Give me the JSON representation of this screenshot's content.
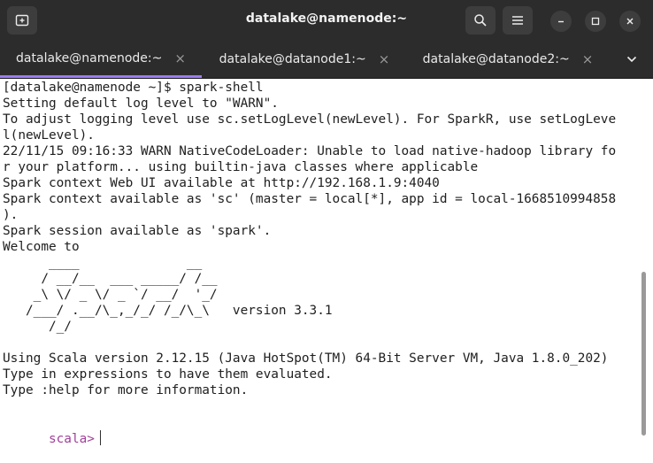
{
  "window": {
    "title": "datalake@namenode:~"
  },
  "tabs": [
    {
      "label": "datalake@namenode:~",
      "close": "×",
      "active": true
    },
    {
      "label": "datalake@datanode1:~",
      "close": "×",
      "active": false
    },
    {
      "label": "datalake@datanode2:~",
      "close": "×",
      "active": false
    }
  ],
  "icons": {
    "new_tab": "new-tab-icon",
    "search": "search-icon",
    "menu": "hamburger-menu-icon",
    "minimize": "minimize-icon",
    "maximize": "maximize-icon",
    "close": "close-icon",
    "overflow": "chevron-down-icon"
  },
  "colors": {
    "titlebar": "#2c2c2c",
    "active_tab_indicator": "#9b7df0",
    "terminal_bg": "#ffffff",
    "terminal_fg": "#202020",
    "prompt": "#a0409a"
  },
  "terminal": {
    "lines": [
      "[datalake@namenode ~]$ spark-shell",
      "Setting default log level to \"WARN\".",
      "To adjust logging level use sc.setLogLevel(newLevel). For SparkR, use setLogLeve",
      "l(newLevel).",
      "22/11/15 09:16:33 WARN NativeCodeLoader: Unable to load native-hadoop library fo",
      "r your platform... using builtin-java classes where applicable",
      "Spark context Web UI available at http://192.168.1.9:4040",
      "Spark context available as 'sc' (master = local[*], app id = local-1668510994858",
      ").",
      "Spark session available as 'spark'.",
      "Welcome to",
      "      ____              __",
      "     / __/__  ___ _____/ /__",
      "    _\\ \\/ _ \\/ _ `/ __/  '_/",
      "   /___/ .__/\\_,_/_/ /_/\\_\\   version 3.3.1",
      "      /_/",
      "",
      "Using Scala version 2.12.15 (Java HotSpot(TM) 64-Bit Server VM, Java 1.8.0_202)",
      "Type in expressions to have them evaluated.",
      "Type :help for more information.",
      ""
    ],
    "prompt": "scala>"
  }
}
